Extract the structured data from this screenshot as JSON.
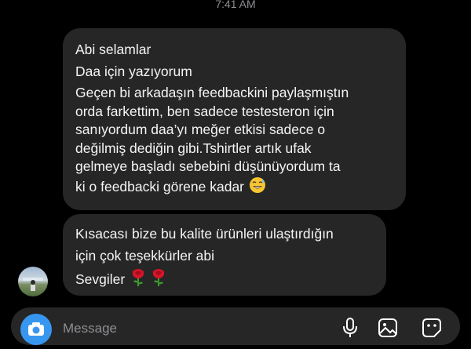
{
  "status": {
    "time": "7:41 AM"
  },
  "messages": [
    {
      "lines": [
        "Abi selamlar",
        "Daa için yazıyorum",
        "Geçen bi arkadaşın feedbackini paylaşmıştın",
        "orda farkettim, ben sadece testesteron için",
        "sanıyordum daa’yı meğer etkisi sadece o",
        "değilmiş dediğin gibi.Tshirtler artık ufak",
        "gelmeye başladı sebebini düşünüyordum  ta",
        "ki o feedbacki görene kadar"
      ],
      "emoji": "sweat-smile-emoji"
    },
    {
      "lines": [
        "Kısacası bize bu kalite ürünleri ulaştırdığın",
        "için çok teşekkürler abi",
        "Sevgiler"
      ],
      "emoji": "rose-emoji"
    }
  ],
  "composer": {
    "placeholder": "Message",
    "icons": [
      "camera-icon",
      "microphone-icon",
      "gallery-icon",
      "sticker-icon"
    ]
  },
  "colors": {
    "background": "#000000",
    "bubble": "#262626",
    "accent": "#3797f0",
    "muted": "#8e8e93"
  }
}
